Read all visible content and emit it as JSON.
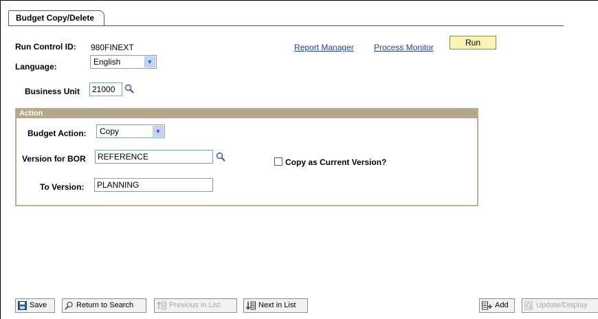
{
  "tab": {
    "label": "Budget Copy/Delete"
  },
  "run_control": {
    "label": "Run Control ID:",
    "value": "980FINEXT"
  },
  "language": {
    "label": "Language:",
    "selected": "English"
  },
  "links": {
    "report_manager": "Report Manager",
    "process_monitor": "Process Monitor"
  },
  "run_button": {
    "label": "Run"
  },
  "business_unit": {
    "label": "Business Unit",
    "value": "21000"
  },
  "action": {
    "header": "Action",
    "budget_action_label": "Budget Action:",
    "budget_action_value": "Copy",
    "version_bor_label": "Version for BOR",
    "version_bor_value": "REFERENCE",
    "copy_current_label": "Copy as Current Version?",
    "to_version_label": "To Version:",
    "to_version_value": "PLANNING"
  },
  "toolbar": {
    "save": "Save",
    "return_to_search": "Return to Search",
    "previous_in_list": "Previous in List",
    "next_in_list": "Next in List",
    "add": "Add",
    "update_display": "Update/Display"
  }
}
